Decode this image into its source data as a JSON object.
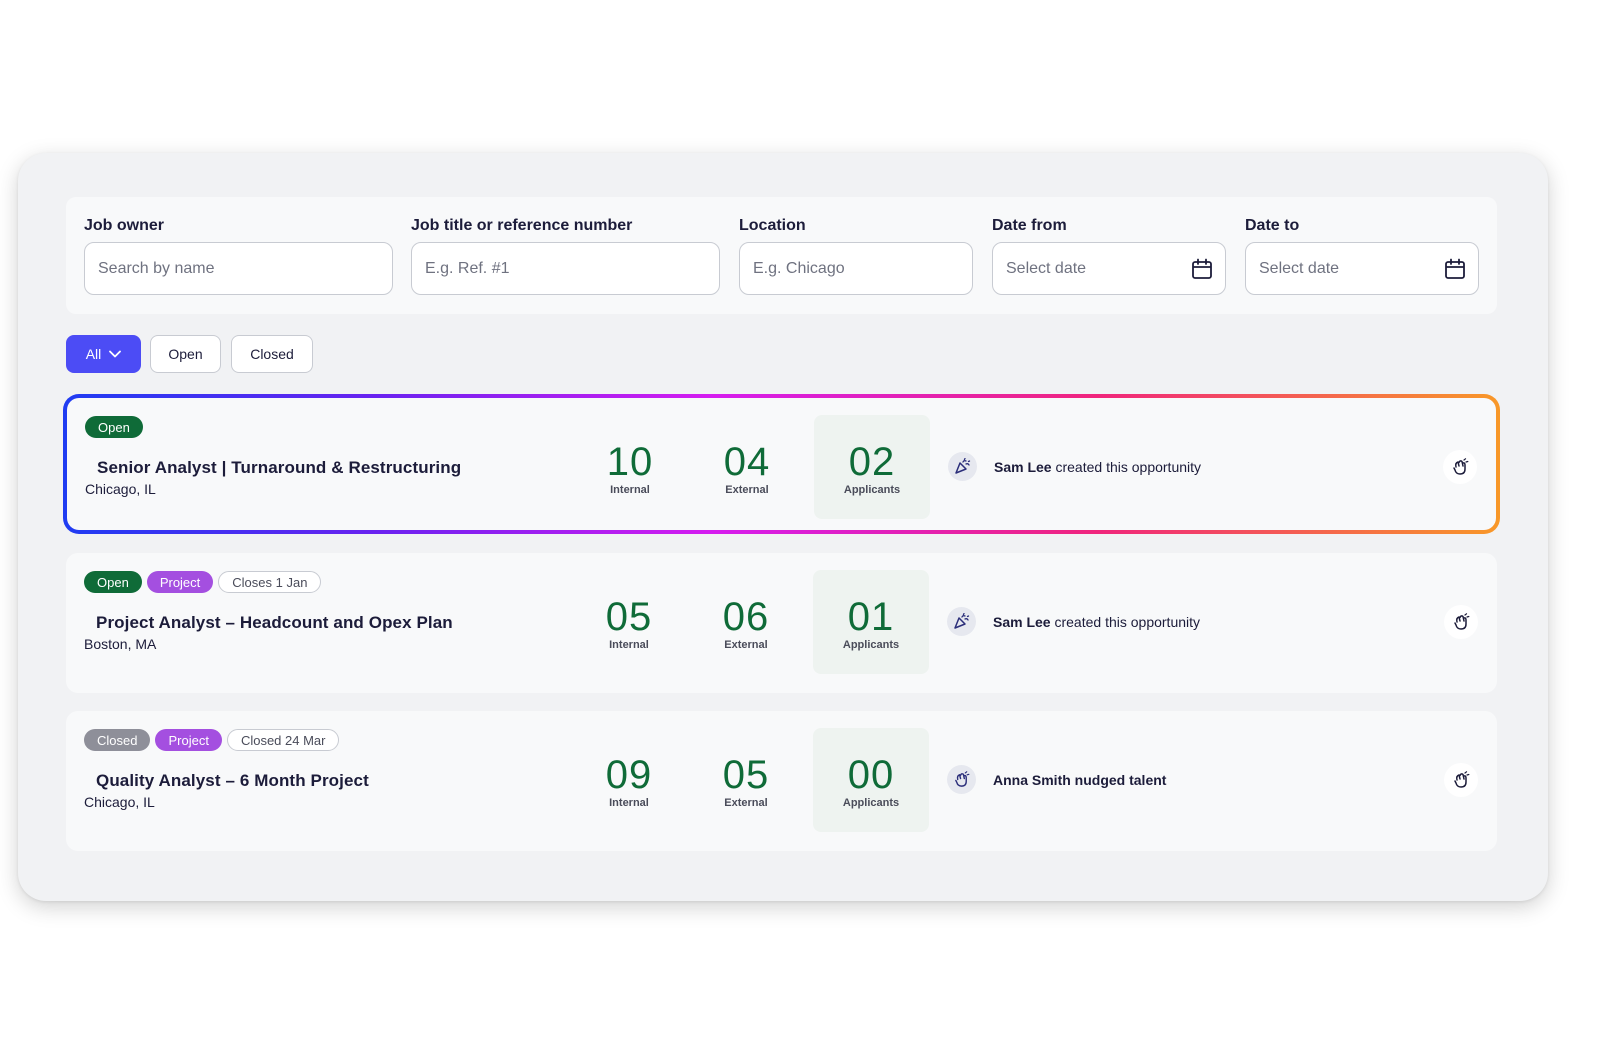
{
  "filters": {
    "job_owner": {
      "label": "Job owner",
      "placeholder": "Search by name"
    },
    "job_title": {
      "label": "Job title or reference number",
      "placeholder": "E.g. Ref. #1"
    },
    "location": {
      "label": "Location",
      "placeholder": "E.g. Chicago"
    },
    "date_from": {
      "label": "Date from",
      "placeholder": "Select date"
    },
    "date_to": {
      "label": "Date to",
      "placeholder": "Select date"
    }
  },
  "tabs": {
    "all": "All",
    "open": "Open",
    "closed": "Closed"
  },
  "stat_labels": {
    "internal": "Internal",
    "external": "External",
    "applicants": "Applicants"
  },
  "jobs": [
    {
      "badges": [
        "Open"
      ],
      "title": "Senior Analyst | Turnaround & Restructuring",
      "location": "Chicago, IL",
      "internal": "10",
      "external": "04",
      "applicants": "02",
      "actor": "Sam Lee",
      "action": " created this opportunity",
      "highlighted": true
    },
    {
      "badges": [
        "Open",
        "Project",
        "Closes 1 Jan"
      ],
      "title": "Project Analyst – Headcount and Opex Plan",
      "location": "Boston, MA",
      "internal": "05",
      "external": "06",
      "applicants": "01",
      "actor": "Sam Lee",
      "action": " created this opportunity"
    },
    {
      "badges": [
        "Closed",
        "Project",
        "Closed 24 Mar"
      ],
      "title": "Quality Analyst – 6 Month Project",
      "location": "Chicago, IL",
      "internal": "09",
      "external": "05",
      "applicants": "00",
      "actor": "Anna Smith",
      "action": " nudged talent"
    }
  ],
  "colors": {
    "accent": "#4c4cf5",
    "status_open": "#0f6b38",
    "status_closed": "#8e8f99",
    "project": "#a44fe0",
    "number_green": "#0f6b38"
  },
  "icons": {
    "date": "calendar-icon",
    "created": "party-popper-icon",
    "nudge": "nudge-hand-icon"
  }
}
